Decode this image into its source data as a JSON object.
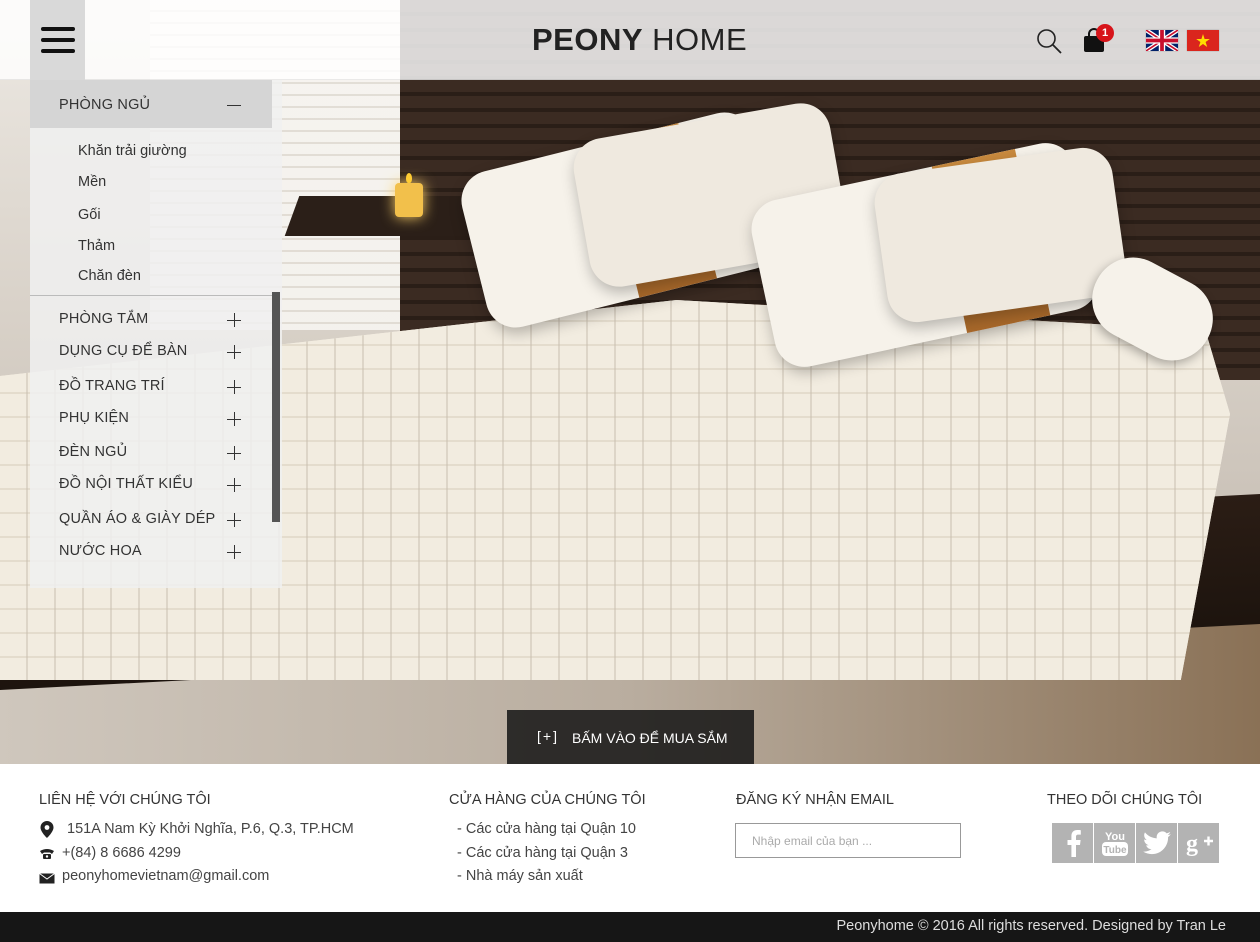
{
  "header": {
    "logo_bold": "PEONY",
    "logo_light": "HOME",
    "cart_count": "1",
    "icons": [
      "menu-icon",
      "search-icon",
      "cart-icon",
      "flag-uk-icon",
      "flag-vn-icon"
    ]
  },
  "sidebar": {
    "open_category": "PHÒNG NGỦ",
    "subcategories": [
      "Khăn trải giường",
      "Mền",
      "Gối",
      "Thảm",
      "Chăn đèn"
    ],
    "categories": [
      "PHÒNG TẮM",
      "DỤNG CỤ ĐỂ BÀN",
      "ĐỒ TRANG TRÍ",
      "PHỤ KIỆN",
      "ĐÈN NGỦ",
      "ĐỒ NỘI THẤT KIỂU",
      "QUẦN ÁO & GIÀY DÉP",
      "NƯỚC HOA"
    ]
  },
  "hero": {
    "shop_plus": "[+]",
    "shop_label": "BẤM VÀO ĐỂ MUA SẮM"
  },
  "footer": {
    "contact": {
      "heading": "LIÊN HỆ VỚI CHÚNG TÔI",
      "address": "151A Nam Kỳ Khởi Nghĩa, P.6, Q.3, TP.HCM",
      "phone": "+(84) 8 6686 4299",
      "email": "peonyhomevietnam@gmail.com"
    },
    "stores": {
      "heading": "CỬA HÀNG CỦA CHÚNG TÔI",
      "items": [
        "- Các cửa hàng tại Quận 10",
        "- Các cửa hàng tại Quận 3",
        "- Nhà máy sản xuất"
      ]
    },
    "newsletter": {
      "heading": "ĐĂNG KÝ NHẬN EMAIL",
      "placeholder": "Nhập email của bạn ..."
    },
    "follow": {
      "heading": "THEO DÕI CHÚNG TÔI",
      "networks": [
        "facebook-icon",
        "youtube-icon",
        "twitter-icon",
        "google-plus-icon"
      ]
    },
    "copyright": "Peonyhome © 2016 All rights reserved. Designed by Tran Le"
  }
}
